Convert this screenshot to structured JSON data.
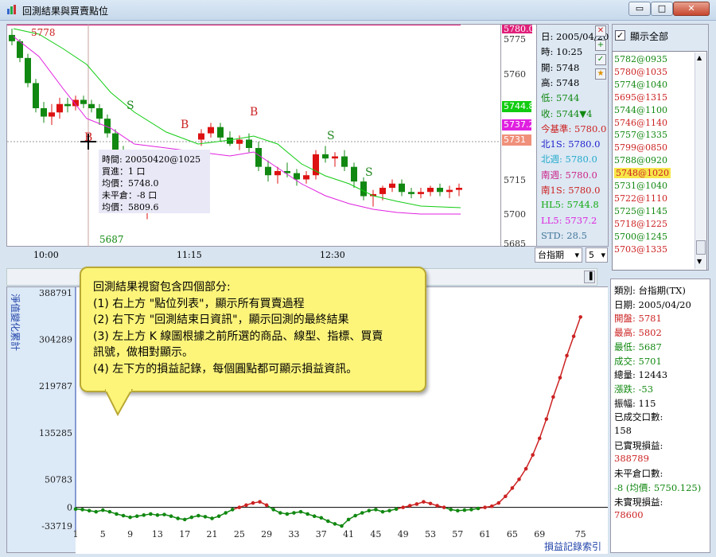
{
  "window": {
    "title": "回測結果與買賣點位",
    "buttons": [
      "▭",
      "□",
      "✕"
    ]
  },
  "price_chart": {
    "y_ticks": [
      "5780.0",
      "5775",
      "5760",
      "5715",
      "5700",
      "5685"
    ],
    "price_tags": [
      {
        "label": "5744.8",
        "color": "#11cc11"
      },
      {
        "label": "5737.2",
        "color": "#e020e0"
      },
      {
        "label": "5731",
        "color": "#f0907a"
      }
    ],
    "high_label": "5778",
    "low_label": "5687",
    "time_ticks": [
      "10:00",
      "11:15",
      "12:30"
    ],
    "signals": [
      {
        "label": "S",
        "color": "#228822"
      },
      {
        "label": "B",
        "color": "#cc2222"
      },
      {
        "label": "S",
        "color": "#228822"
      },
      {
        "label": "B",
        "color": "#cc2222"
      },
      {
        "label": "S",
        "color": "#228822"
      },
      {
        "label": "B",
        "color": "#cc2222"
      }
    ]
  },
  "tooltip": {
    "lines": [
      "時間: 20050420@1025",
      "買進：1 口",
      "均價：5748.0",
      "未平倉：-8 口",
      "均價：5809.6"
    ]
  },
  "bar_info": {
    "lines": [
      {
        "text": "日: 2005/04/20",
        "color": "#000000"
      },
      {
        "text": "時: 10:25",
        "color": "#000000"
      },
      {
        "text": "開: 5748",
        "color": "#000000"
      },
      {
        "text": "高: 5748",
        "color": "#000000"
      },
      {
        "text": "低: 5744",
        "color": "#118811"
      },
      {
        "text": "收: 5744▼4",
        "color": "#118811"
      },
      {
        "text": "今基準: 5780.0",
        "color": "#cc2222"
      },
      {
        "text": "北1S: 5780.0",
        "color": "#2222cc"
      },
      {
        "text": "北週: 5780.0",
        "color": "#22aacc"
      },
      {
        "text": "南週: 5780.0",
        "color": "#cc2288"
      },
      {
        "text": "南1S: 5780.0",
        "color": "#cc2222"
      },
      {
        "text": "HL5: 5744.8",
        "color": "#11aa11"
      },
      {
        "text": "LL5: 5737.2",
        "color": "#dd22dd"
      },
      {
        "text": "STD: 28.5",
        "color": "#447799"
      }
    ]
  },
  "selectors": {
    "product": "台指期",
    "interval": "5"
  },
  "point_list": {
    "show_all_label": "顯示全部",
    "show_all_checked": true,
    "items": [
      {
        "text": "5782@0935",
        "color": "#118811",
        "selected": false
      },
      {
        "text": "5780@1035",
        "color": "#cc2222",
        "selected": false
      },
      {
        "text": "5774@1040",
        "color": "#118811",
        "selected": false
      },
      {
        "text": "5695@1315",
        "color": "#cc2222",
        "selected": false
      },
      {
        "text": "5744@1100",
        "color": "#118811",
        "selected": false
      },
      {
        "text": "5746@1140",
        "color": "#cc2222",
        "selected": false
      },
      {
        "text": "5757@1335",
        "color": "#118811",
        "selected": false
      },
      {
        "text": "5799@0850",
        "color": "#cc2222",
        "selected": false
      },
      {
        "text": "5788@0920",
        "color": "#118811",
        "selected": false
      },
      {
        "text": "5748@1020",
        "color": "#cc2222",
        "selected": true
      },
      {
        "text": "5731@1040",
        "color": "#118811",
        "selected": false
      },
      {
        "text": "5722@1110",
        "color": "#cc2222",
        "selected": false
      },
      {
        "text": "5725@1145",
        "color": "#118811",
        "selected": false
      },
      {
        "text": "5718@1225",
        "color": "#cc2222",
        "selected": false
      },
      {
        "text": "5700@1245",
        "color": "#118811",
        "selected": false
      },
      {
        "text": "5703@1335",
        "color": "#cc2222",
        "selected": false
      }
    ]
  },
  "summary": {
    "lines": [
      {
        "text": "類別:    台指期(TX)",
        "color": "#000000"
      },
      {
        "text": "日期:    2005/04/20",
        "color": "#000000"
      },
      {
        "text": "開盤:    5781",
        "color": "#cc2222"
      },
      {
        "text": "最高:    5802",
        "color": "#cc2222"
      },
      {
        "text": "最低:    5687",
        "color": "#118811"
      },
      {
        "text": "成交:    5701",
        "color": "#118811"
      },
      {
        "text": "總量:    12443",
        "color": "#000000"
      },
      {
        "text": "漲跌:    -53",
        "color": "#118811"
      },
      {
        "text": "振幅:    115",
        "color": "#000000"
      },
      {
        "text": "已成交口數:",
        "color": "#000000"
      },
      {
        "text": "158",
        "color": "#000000"
      },
      {
        "text": "已實現損益:",
        "color": "#000000"
      },
      {
        "text": "388789",
        "color": "#cc2222"
      },
      {
        "text": "未平倉口數:",
        "color": "#000000"
      },
      {
        "text": "-8 (均價: 5750.125)",
        "color": "#118811"
      },
      {
        "text": "未實現損益:",
        "color": "#000000"
      },
      {
        "text": "78600",
        "color": "#cc2222"
      }
    ]
  },
  "callout": {
    "lines": [
      "回測結果視窗包含四個部分:",
      "(1) 右上方 \"點位列表\"，顯示所有買賣過程",
      "(2) 右下方 \"回測結束日資訊\"，顯示回測的最終結果",
      "(3) 左上方 K 線圖根據之前所選的商品、線型、指標、買賣",
      "訊號，做相對顯示。",
      "(4) 左下方的損益記錄，每個圓點都可顯示損益資訊。"
    ]
  },
  "chart_data": {
    "type": "line",
    "title": "",
    "ylabel": "淨值變化累計",
    "xlabel": "損益記錄索引",
    "x_ticks": [
      1,
      5,
      9,
      13,
      17,
      21,
      25,
      29,
      33,
      37,
      41,
      45,
      49,
      53,
      57,
      61,
      65,
      69,
      75
    ],
    "y_ticks": [
      -33719,
      0,
      50783,
      135285,
      219787,
      304289,
      388791
    ],
    "ylim": [
      -33719,
      388791
    ],
    "xlim": [
      1,
      79
    ],
    "series": [
      {
        "color_positive": "#cc2222",
        "color_negative": "#118811",
        "x": [
          1,
          2,
          3,
          4,
          5,
          6,
          7,
          8,
          9,
          10,
          11,
          12,
          13,
          14,
          15,
          16,
          17,
          18,
          19,
          20,
          21,
          22,
          23,
          24,
          25,
          26,
          27,
          28,
          29,
          30,
          31,
          32,
          33,
          34,
          35,
          36,
          37,
          38,
          39,
          40,
          41,
          42,
          43,
          44,
          45,
          46,
          47,
          48,
          49,
          50,
          51,
          52,
          53,
          54,
          55,
          56,
          57,
          58,
          59,
          60,
          61,
          62,
          63,
          64,
          65,
          66,
          67,
          68,
          69,
          70,
          71,
          72,
          73,
          74,
          75
        ],
        "values": [
          -3000,
          -4000,
          -6000,
          -8000,
          -5000,
          -8000,
          -12000,
          -15000,
          -18000,
          -16000,
          -14000,
          -12000,
          -14000,
          -13000,
          -16000,
          -20000,
          -22000,
          -18000,
          -15000,
          -17000,
          -20000,
          -16000,
          -10000,
          -4000,
          0,
          4000,
          8000,
          10000,
          4000,
          -4000,
          -10000,
          -12000,
          -10000,
          -8000,
          -12000,
          -16000,
          -19000,
          -25000,
          -30000,
          -33719,
          -22000,
          -15000,
          -10000,
          -6000,
          -4000,
          -8000,
          -6000,
          -3000,
          0,
          3000,
          6000,
          10000,
          7000,
          3000,
          0,
          -4000,
          -6000,
          -5000,
          -4000,
          -2000,
          0,
          2000,
          8000,
          20000,
          35000,
          50783,
          70000,
          95000,
          125000,
          160000,
          200000,
          235000,
          275000,
          310000,
          345000
        ]
      }
    ]
  }
}
